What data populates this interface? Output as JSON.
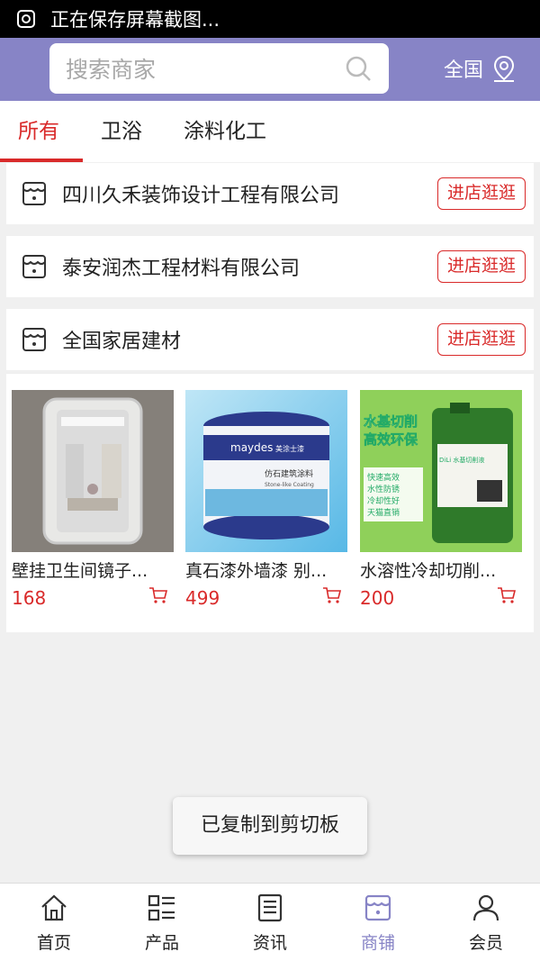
{
  "status_bar": {
    "text": "正在保存屏幕截图..."
  },
  "header": {
    "search_placeholder": "搜索商家",
    "region": "全国"
  },
  "tabs": [
    {
      "label": "所有",
      "active": true
    },
    {
      "label": "卫浴",
      "active": false
    },
    {
      "label": "涂料化工",
      "active": false
    }
  ],
  "shops": [
    {
      "name": "四川久禾装饰设计工程有限公司",
      "button": "进店逛逛"
    },
    {
      "name": "泰安润杰工程材料有限公司",
      "button": "进店逛逛"
    },
    {
      "name": "全国家居建材",
      "button": "进店逛逛"
    }
  ],
  "products": [
    {
      "name": "壁挂卫生间镜子...",
      "price": "168"
    },
    {
      "name": "真石漆外墙漆 别...",
      "price": "499",
      "image_text": {
        "brand": "maydes",
        "brand_cn": "美涂士漆",
        "label": "仿石建筑涂料",
        "label_en": "Stone-like Coating"
      }
    },
    {
      "name": "水溶性冷却切削...",
      "price": "200",
      "image_text": {
        "headline1": "水基切削",
        "headline2": "高效环保",
        "features": [
          "快速高效",
          "水性防锈",
          "冷却性好",
          "天猫直销"
        ],
        "drum_label": "DiLi 水基切削液"
      }
    }
  ],
  "toast": "已复制到剪切板",
  "tabbar": [
    {
      "label": "首页",
      "icon": "home-icon",
      "active": false
    },
    {
      "label": "产品",
      "icon": "grid-list-icon",
      "active": false
    },
    {
      "label": "资讯",
      "icon": "news-icon",
      "active": false
    },
    {
      "label": "商铺",
      "icon": "shop-icon",
      "active": true
    },
    {
      "label": "会员",
      "icon": "user-icon",
      "active": false
    }
  ],
  "colors": {
    "accent": "#8784c6",
    "highlight": "#d92a2a"
  }
}
